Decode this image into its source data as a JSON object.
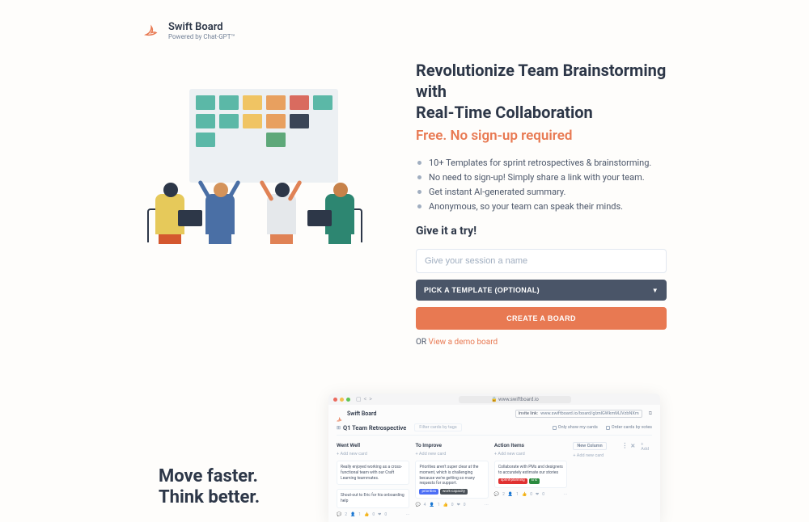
{
  "brand": {
    "name": "Swift Board",
    "subtitle": "Powered by Chat-GPT™"
  },
  "hero": {
    "headline_line1": "Revolutionize Team Brainstorming with",
    "headline_line2": "Real-Time Collaboration",
    "subheadline": "Free. No sign-up required",
    "features": [
      "10+ Templates for sprint retrospectives & brainstorming.",
      "No need to sign-up! Simply share a link with your team.",
      "Get instant AI-generated summary.",
      "Anonymous, so your team can speak their minds."
    ],
    "cta_title": "Give it a try!",
    "input_placeholder": "Give your session a name",
    "template_label": "PICK A TEMPLATE (OPTIONAL)",
    "create_label": "CREATE A BOARD",
    "or_text": "OR ",
    "demo_link": "View a demo board"
  },
  "section2": {
    "title": "Move faster. Think better."
  },
  "demo": {
    "url": "www.swiftboard.io",
    "brand": "Swift Board",
    "invite_label": "Invite link:",
    "invite_url": "www.swiftboard.io/board/gIznlGWkmMJVzbNXm",
    "board_title": "Q1 Team Retrospective",
    "filter_placeholder": "Filter cards by tags",
    "only_mine": "Only show my cards",
    "order_votes": "Order cards by votes",
    "add_card": "+  Add new card",
    "new_column": "New Column",
    "add_label": "+  Add",
    "columns": [
      {
        "title": "Went Well",
        "cards": [
          {
            "text": "Really enjoyed working as a cross-functional team with our Craft Learning teammates.",
            "tags": [],
            "footer": {
              "comments": "2",
              "votes": "1",
              "likes": "0",
              "reactions": "0"
            }
          },
          {
            "text": "Shout-out to Eric for his onboarding help",
            "tags": [],
            "footer": null
          }
        ]
      },
      {
        "title": "To Improve",
        "cards": [
          {
            "text": "Priorities aren't super clear at the moment, which is challenging because we're getting so many requests for support.",
            "tags": [
              {
                "label": "priorities",
                "color": "blue"
              },
              {
                "label": "work-capacity",
                "color": "gray"
              }
            ],
            "footer": {
              "comments": "4",
              "votes": "1",
              "likes": "0",
              "reactions": "0"
            }
          }
        ]
      },
      {
        "title": "Action Items",
        "cards": [
          {
            "text": "Collaborate with PMs and designers to accurately estimate our stories",
            "tags": [
              {
                "label": "sprint-planning",
                "color": "red"
              },
              {
                "label": "Eric",
                "color": "green"
              }
            ],
            "footer": {
              "comments": "2",
              "votes": "1",
              "likes": "0",
              "reactions": "0"
            }
          }
        ]
      }
    ]
  }
}
